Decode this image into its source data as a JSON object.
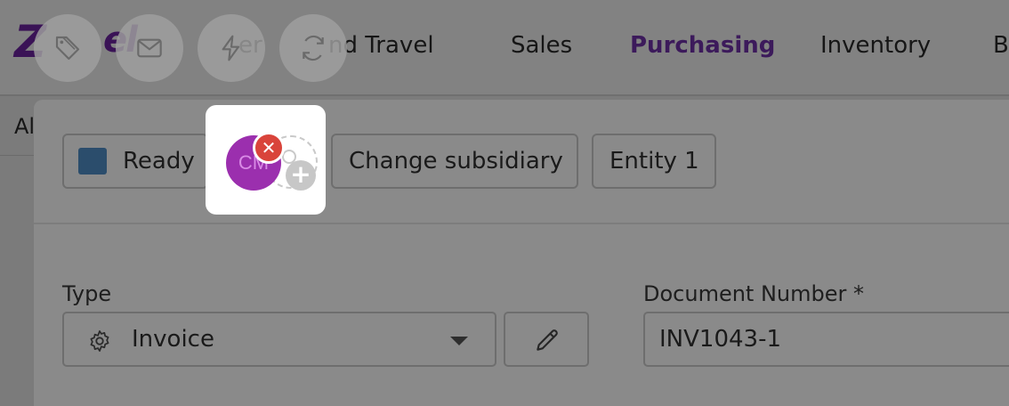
{
  "nav": {
    "logo_partial": "Z",
    "logo_partial_2": "el",
    "items": [
      {
        "label": "er",
        "visible_fragment": true
      },
      {
        "label": "nd Travel"
      },
      {
        "label": "Sales"
      },
      {
        "label": "Purchasing",
        "active": true
      },
      {
        "label": "Inventory"
      },
      {
        "label": "B"
      }
    ]
  },
  "sidebar": {
    "fragment": "Al"
  },
  "floating_actions": [
    {
      "icon": "tag-icon"
    },
    {
      "icon": "mail-icon"
    },
    {
      "icon": "lightning-icon"
    },
    {
      "icon": "refresh-icon"
    }
  ],
  "status_bar": {
    "status_label": "Ready",
    "status_color": "#2b4d6c",
    "change_subsidiary_label": "Change subsidiary",
    "entity_label": "Entity 1"
  },
  "assignee": {
    "initials": "CM",
    "avatar_color": "#9b2fae",
    "remove_icon": "close-icon",
    "add_icon": "add-user-icon"
  },
  "form": {
    "type_label": "Type",
    "type_value": "Invoice",
    "type_icon": "gear-icon",
    "doc_number_label": "Document Number *",
    "doc_number_value": "INV1043-1"
  },
  "colors": {
    "accent": "#3c1a5b",
    "remove": "#d9443b"
  }
}
